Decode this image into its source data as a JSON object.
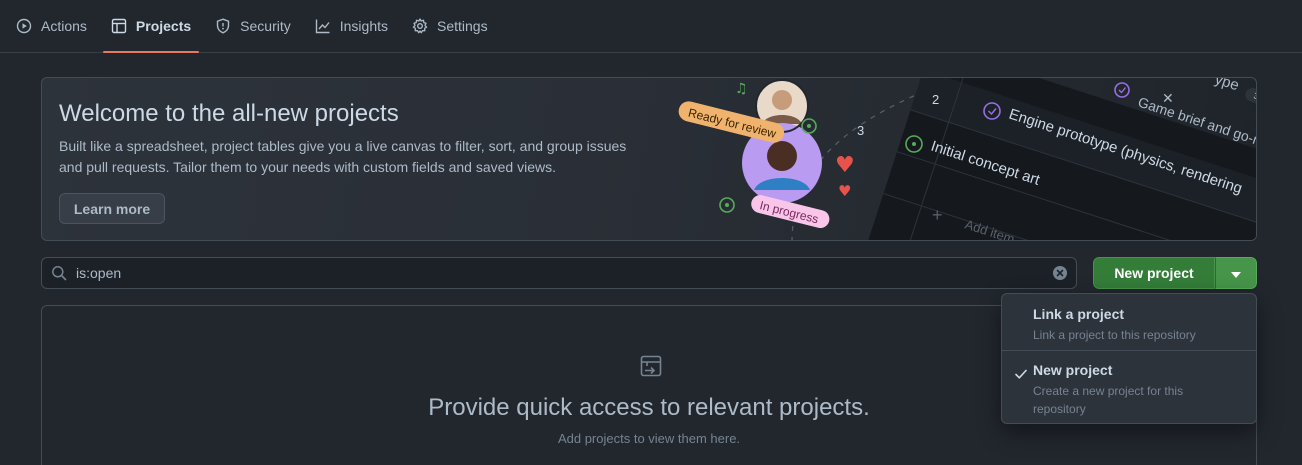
{
  "nav": {
    "tabs": [
      {
        "label": "Actions",
        "icon": "play-icon"
      },
      {
        "label": "Projects",
        "icon": "table-icon",
        "selected": true
      },
      {
        "label": "Security",
        "icon": "shield-icon"
      },
      {
        "label": "Insights",
        "icon": "graph-icon"
      },
      {
        "label": "Settings",
        "icon": "gear-icon"
      }
    ]
  },
  "banner": {
    "title": "Welcome to the all-new projects",
    "description": "Built like a spreadsheet, project tables give you a live canvas to filter, sort, and group issues and pull requests. Tailor them to your needs with custom fields and saved views.",
    "learn_more": "Learn more",
    "illustration": {
      "rows": [
        {
          "num": "2",
          "text": "Engine prototype (physics, rendering"
        },
        {
          "num": "3",
          "text": "Initial concept art"
        },
        {
          "num": "",
          "text": "Game brief and go-no"
        }
      ],
      "badge_count": "3",
      "add_item": "Add item",
      "tag_ready": "Ready for review",
      "tag_progress": "In progress",
      "header_fragment": "ype"
    }
  },
  "search": {
    "value": "is:open"
  },
  "new_project": {
    "label": "New project"
  },
  "menu": {
    "items": [
      {
        "title": "Link a project",
        "description": "Link a project to this repository",
        "checked": false
      },
      {
        "title": "New project",
        "description": "Create a new project for this repository",
        "checked": true
      }
    ]
  },
  "empty_state": {
    "title": "Provide quick access to relevant projects.",
    "subtitle": "Add projects to view them here."
  },
  "colors": {
    "background": "#22272e",
    "accent_underline": "#ec775c",
    "primary_button": "#347d39",
    "ready_tag": "#f0b36d",
    "progress_tag": "#f9c5e8"
  }
}
